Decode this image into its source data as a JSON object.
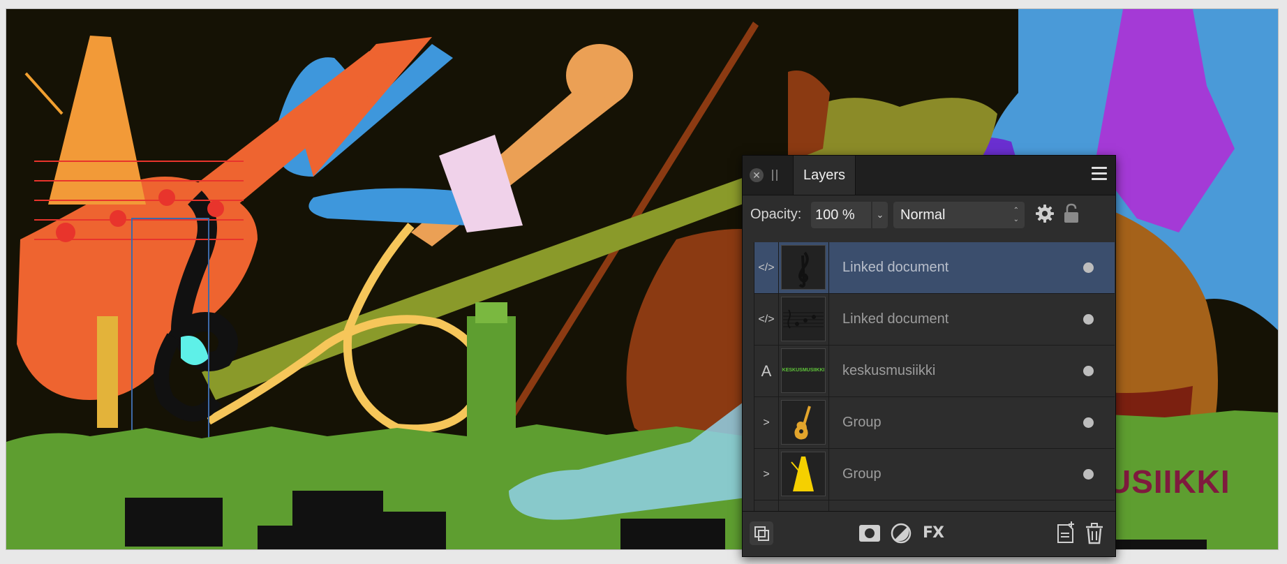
{
  "canvas": {
    "word": "USIIKKI"
  },
  "layers_panel": {
    "tab_label": "Layers",
    "opacity_label": "Opacity:",
    "opacity_value": "100 %",
    "blend_mode": "Normal",
    "icons": {
      "close": "close-icon",
      "menu": "menu-icon",
      "settings": "gear-icon",
      "lock": "lock-icon"
    },
    "layers": [
      {
        "type_icon": "</>",
        "name": "Linked document",
        "thumb": "treble-clef",
        "selected": true
      },
      {
        "type_icon": "</>",
        "name": "Linked document",
        "thumb": "music-notes",
        "selected": false
      },
      {
        "type_icon": "A",
        "name": "keskusmusiikki",
        "thumb": "text",
        "thumb_text": "KESKUSMUSIIKKI",
        "selected": false
      },
      {
        "type_icon": ">",
        "name": "Group",
        "thumb": "guitar",
        "selected": false
      },
      {
        "type_icon": ">",
        "name": "Group",
        "thumb": "metronome",
        "selected": false
      }
    ],
    "footer_icons": [
      "copy-layers-icon",
      "mask-icon",
      "adjustment-icon",
      "fx-icon",
      "add-layer-icon",
      "trash-icon"
    ],
    "fx_label": "FX"
  }
}
